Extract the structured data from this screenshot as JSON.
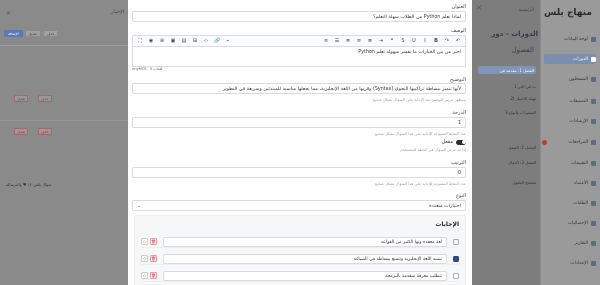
{
  "sidebar": {
    "title": "منهاج بلس",
    "items": [
      {
        "label": "لوحة البيانات",
        "active": false
      },
      {
        "label": "الدورات",
        "active": true
      },
      {
        "label": "المسجلون",
        "active": false
      },
      {
        "label": "التصنيفات",
        "active": false
      },
      {
        "label": "الإرشادات",
        "active": false
      },
      {
        "label": "المراجعات",
        "active": false,
        "badge": true
      },
      {
        "label": "التقييمات",
        "active": false
      },
      {
        "label": "الأعضاء",
        "active": false
      },
      {
        "label": "الطلبات",
        "active": false
      },
      {
        "label": "الإحصائيات",
        "active": false
      },
      {
        "label": "التقارير",
        "active": false
      },
      {
        "label": "الإعدادات",
        "active": false
      }
    ]
  },
  "course_panel": {
    "header": "الرئيسية",
    "course_title": "الدورات - دور",
    "section_heading": "الفصول",
    "active_chip": "الفصل 1: مقدمة في",
    "lines": [
      "1 ب في الدر",
      "2) تهيئة الاختبار",
      "3 المتغيرات وأنواع",
      "الفصل 2: الجمل",
      "الفصل 3: الدوال",
      "تصحيح الحلول"
    ]
  },
  "left_panel": {
    "header": "الإختبار",
    "tabs": [
      "الإضافة",
      "تعديل",
      "حذف"
    ],
    "row_buttons": [
      "تعديل",
      "حذف"
    ],
    "footer": "سؤال بلس ١٢ ♥ والترسالة"
  },
  "modal": {
    "title_label": "العنوان",
    "title_value": "لماذا تعلم Python من الطلاب سهلة التعلم؟",
    "desc_label": "الوصف",
    "editor_text": "اختر من بين الخيارات ما يفسر سهولة تعلم Python",
    "status_words": "3 كلمات",
    "status_brand": "tinyMCE",
    "explanation_label": "التوضيح",
    "explanation_value": "لأنها تتميز ببساطة تراكيبها النحوي (Syntax) وقربها من اللغة الإنجليزية، مما يجعلها مناسبة للمبتدئين وسريعة في التطوير",
    "explanation_hint": "سيظهر عرض التوضيح بعد الإجابة على السؤال بشكل صحيح",
    "score_label": "الدرجة",
    "score_value": "1",
    "score_hint": "عدد النقاط الممنوحة للإجابة على هذا السؤال بشكل صحيح",
    "toggle_label": "مفعل",
    "toggle_hint": "إذا تم عرض السؤال في الخطة للمستخدم",
    "order_label": "الترتيب",
    "order_value": "0",
    "order_hint": "عدد النقاط الممنوحة للإجابة على هذا السؤال بشكل صحيح",
    "type_label": "النوع",
    "type_value": "اختيارات متعددة",
    "answers_title": "الإجابات",
    "answers": [
      {
        "text": "لغة معقدة وبها الكثير من القواعد",
        "checked": false
      },
      {
        "text": "تشبه اللغة الإنجليزية وتتمتع ببساطة في الصياغة",
        "checked": true
      },
      {
        "text": "تتطلب معرفة متقدمة بالبرمجة",
        "checked": false
      }
    ]
  },
  "colors": {
    "primary": "#2f4a86",
    "danger": "#c0392b",
    "overlay": "#7d7d7d"
  }
}
